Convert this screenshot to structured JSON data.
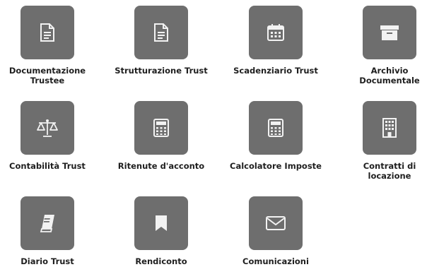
{
  "tiles": [
    {
      "label": [
        "Documentazione",
        "Trustee"
      ],
      "icon": "document-icon"
    },
    {
      "label": [
        "Strutturazione Trust"
      ],
      "icon": "document-icon"
    },
    {
      "label": [
        "Scadenziario Trust"
      ],
      "icon": "calendar-icon"
    },
    {
      "label": [
        "Archivio",
        "Documentale"
      ],
      "icon": "archive-box-icon"
    },
    {
      "label": [
        "Contabilità Trust"
      ],
      "icon": "balance-scale-icon"
    },
    {
      "label": [
        "Ritenute d'acconto"
      ],
      "icon": "calculator-icon"
    },
    {
      "label": [
        "Calcolatore Imposte"
      ],
      "icon": "calculator-icon"
    },
    {
      "label": [
        "Contratti di",
        "locazione"
      ],
      "icon": "building-icon"
    },
    {
      "label": [
        "Diario Trust"
      ],
      "icon": "book-icon"
    },
    {
      "label": [
        "Rendiconto"
      ],
      "icon": "bookmark-icon"
    },
    {
      "label": [
        "Comunicazioni"
      ],
      "icon": "envelope-icon"
    }
  ],
  "colors": {
    "tile_bg": "#6e6e6e",
    "icon": "#f2f2f2",
    "label": "#1f1f1f"
  }
}
